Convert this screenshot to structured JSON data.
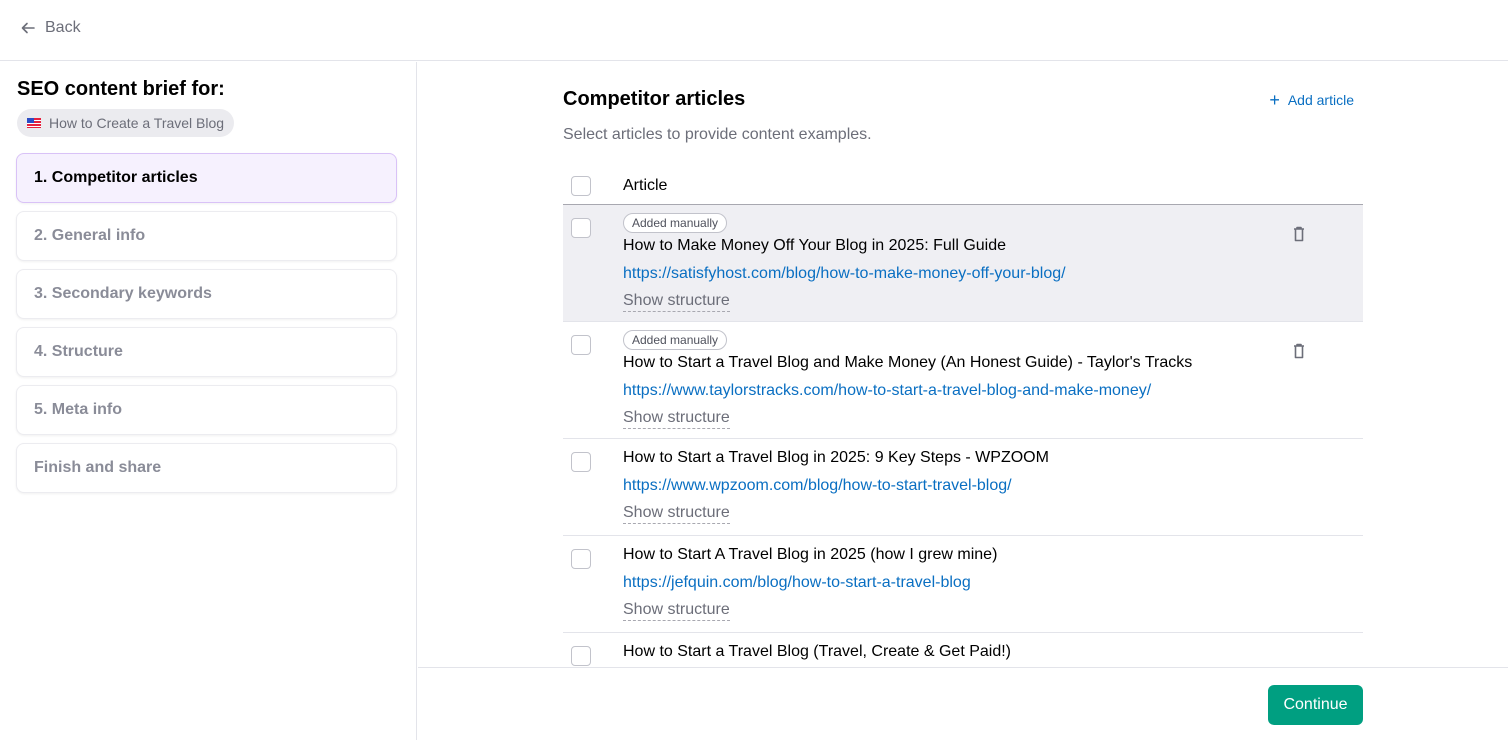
{
  "topbar": {
    "back_label": "Back"
  },
  "sidebar": {
    "title": "SEO content brief for:",
    "keyword": {
      "flag": "US",
      "label": "How to Create a Travel Blog"
    },
    "steps": [
      {
        "label": "1. Competitor articles",
        "active": true
      },
      {
        "label": "2. General info",
        "active": false
      },
      {
        "label": "3. Secondary keywords",
        "active": false
      },
      {
        "label": "4. Structure",
        "active": false
      },
      {
        "label": "5. Meta info",
        "active": false
      },
      {
        "label": "Finish and share",
        "active": false
      }
    ]
  },
  "main": {
    "title": "Competitor articles",
    "add_article_label": "Add article",
    "subtitle": "Select articles to provide content examples.",
    "table": {
      "column_header": "Article",
      "rows": [
        {
          "badge": "Added manually",
          "title": "How to Make Money Off Your Blog in 2025: Full Guide",
          "url": "https://satisfyhost.com/blog/how-to-make-money-off-your-blog/",
          "show_structure": "Show structure",
          "checked": false,
          "deletable": true
        },
        {
          "badge": "Added manually",
          "title": "How to Start a Travel Blog and Make Money (An Honest Guide) - Taylor's Tracks",
          "url": "https://www.taylorstracks.com/how-to-start-a-travel-blog-and-make-money/",
          "show_structure": "Show structure",
          "checked": false,
          "deletable": true
        },
        {
          "badge": null,
          "title": "How to Start a Travel Blog in 2025: 9 Key Steps - WPZOOM",
          "url": "https://www.wpzoom.com/blog/how-to-start-travel-blog/",
          "show_structure": "Show structure",
          "checked": false,
          "deletable": false
        },
        {
          "badge": null,
          "title": "How to Start A Travel Blog in 2025 (how I grew mine)",
          "url": "https://jefquin.com/blog/how-to-start-a-travel-blog",
          "show_structure": "Show structure",
          "checked": false,
          "deletable": false
        },
        {
          "badge": null,
          "title": "How to Start a Travel Blog (Travel, Create & Get Paid!)",
          "url": null,
          "show_structure": null,
          "checked": false,
          "deletable": false
        }
      ]
    }
  },
  "footer": {
    "continue_label": "Continue"
  },
  "colors": {
    "accent_link": "#0a6fc2",
    "primary_button": "#009f81",
    "active_step_bg": "#f6f1fe",
    "active_step_border": "#d9c2f7"
  }
}
